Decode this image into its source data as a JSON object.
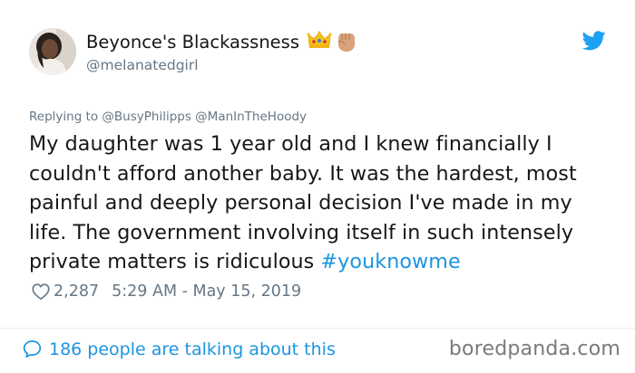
{
  "user": {
    "display_name": "Beyonce's Blackassness",
    "handle": "@melanatedgirl",
    "emoji": [
      "crown-emoji",
      "raised-fist-emoji"
    ]
  },
  "reply": {
    "prefix": "Replying to",
    "mentions": [
      "@BusyPhilipps",
      "@ManInTheHoody"
    ]
  },
  "tweet": {
    "text": "My daughter was 1 year old and I knew financially I couldn't afford another baby. It was the hardest, most painful and deeply personal decision I've made in my life. The government involving itself in such intensely private matters is ridiculous ",
    "hashtag": "#youknowme"
  },
  "meta": {
    "likes": "2,287",
    "timestamp": "5:29 AM - May 15, 2019"
  },
  "footer": {
    "talking": "186 people are talking about this",
    "watermark": "boredpanda.com"
  },
  "colors": {
    "link": "#1b95e0",
    "muted": "#657786",
    "text": "#14171a"
  }
}
